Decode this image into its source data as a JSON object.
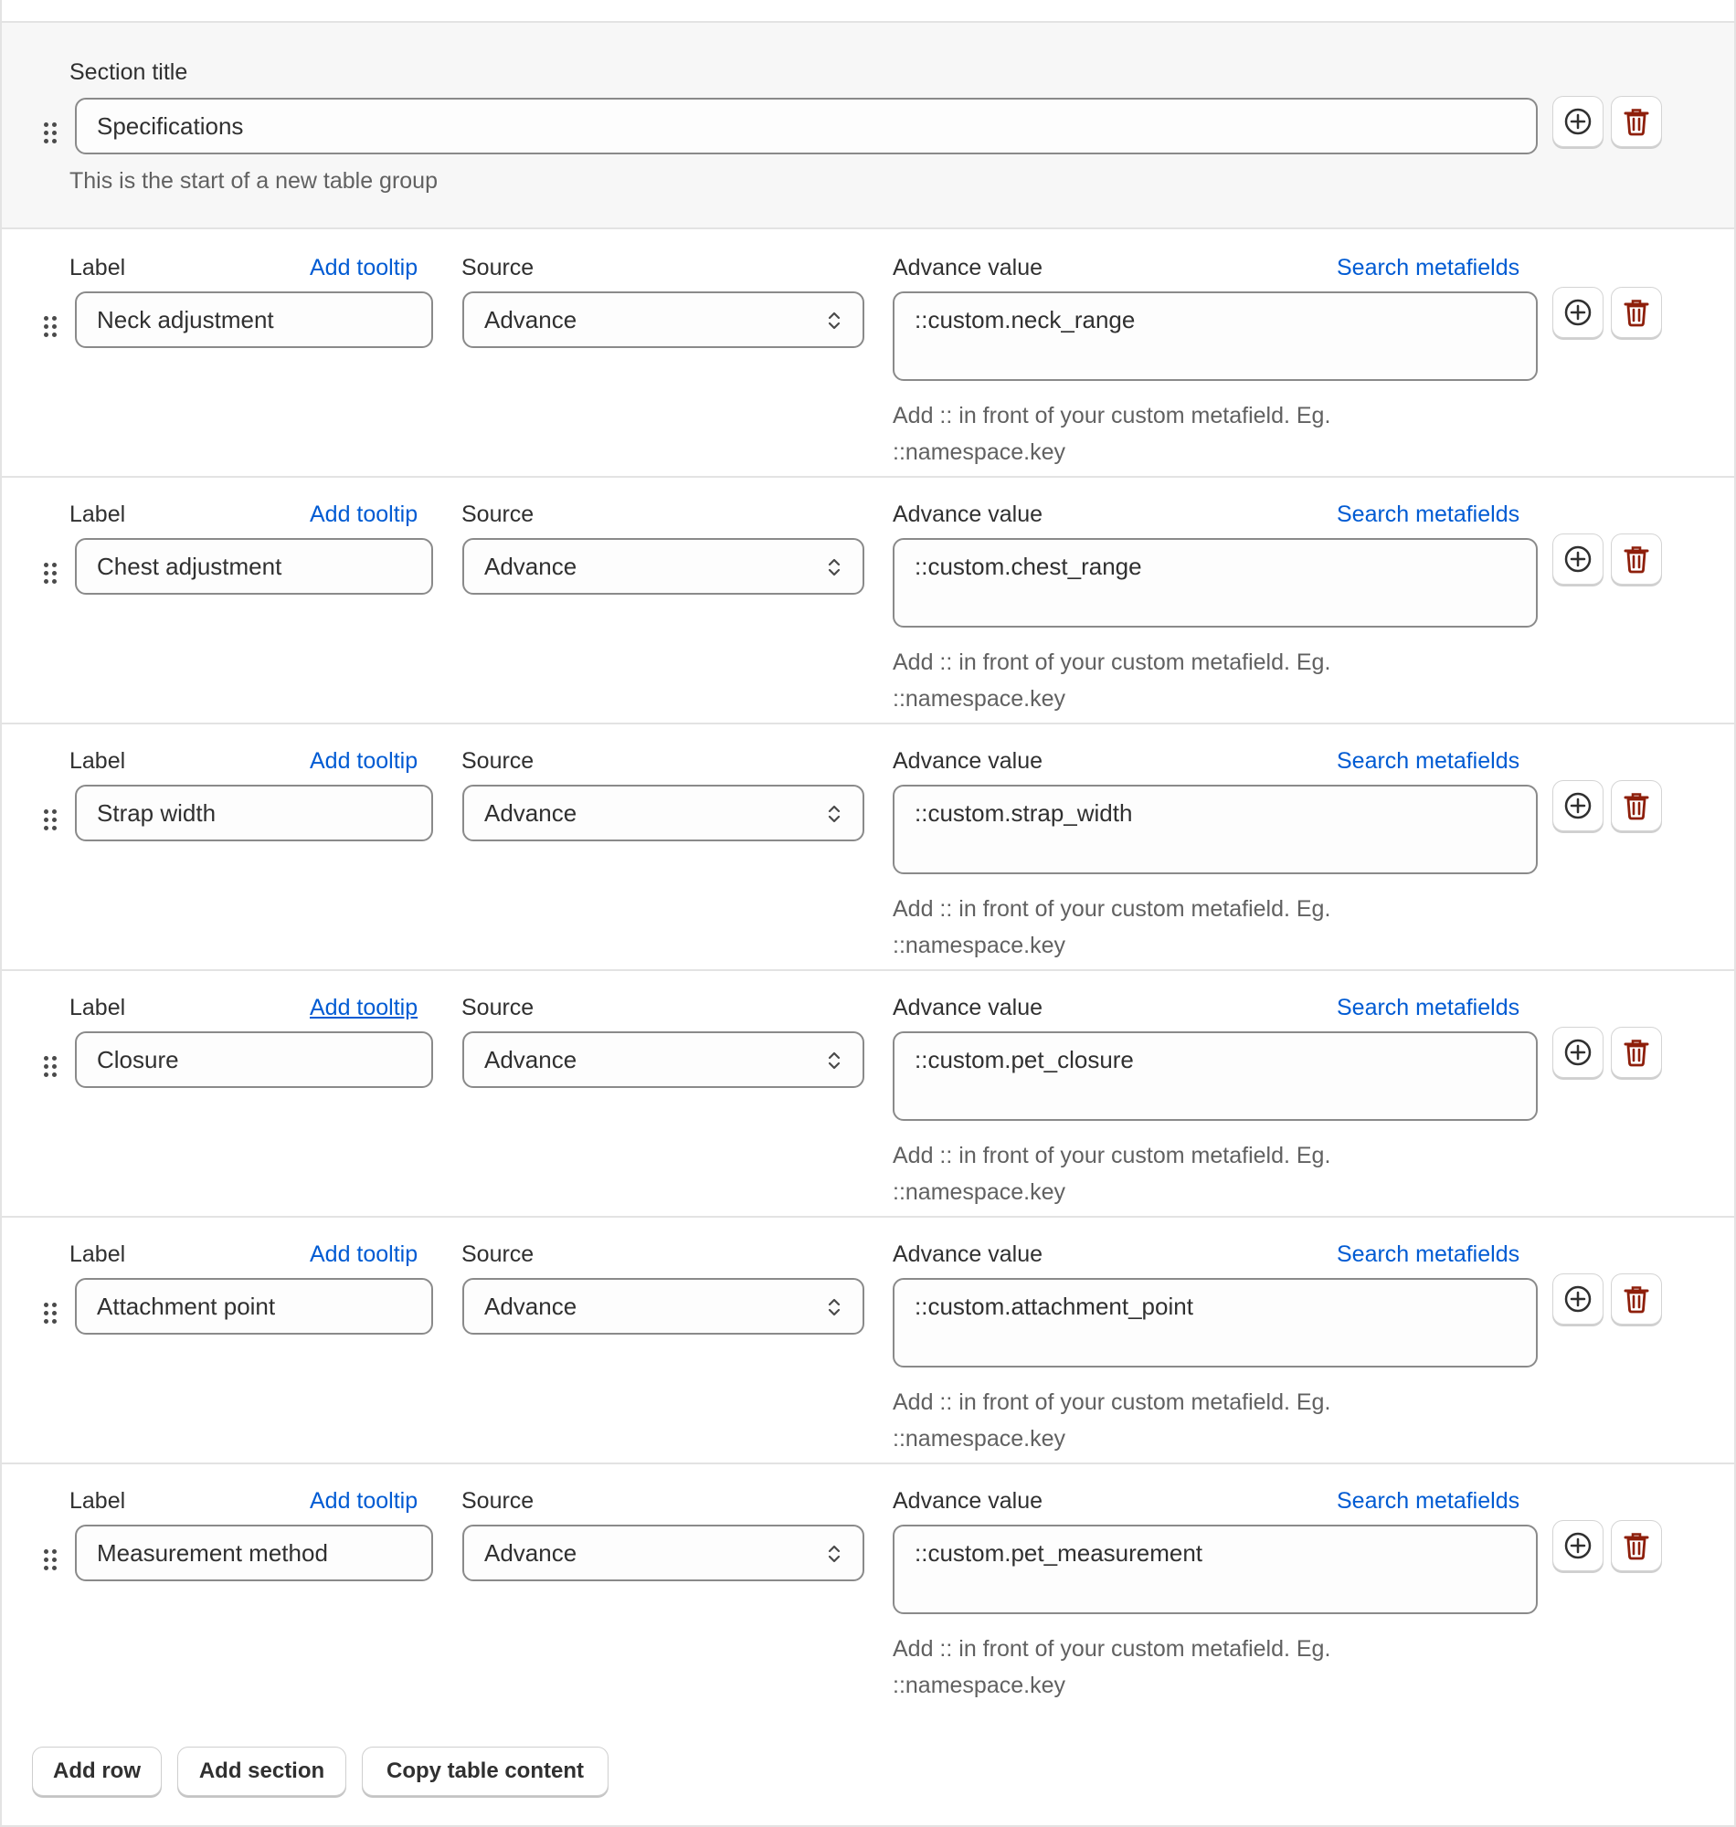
{
  "section": {
    "title_label": "Section title",
    "title_value": "Specifications",
    "help": "This is the start of a new table group"
  },
  "rows": [
    {
      "label_heading": "Label",
      "tooltip_link": "Add tooltip",
      "source_heading": "Source",
      "value_heading": "Advance value",
      "search_link": "Search metafields",
      "label_value": "Neck adjustment",
      "source_value": "Advance",
      "advance_value": "::custom.neck_range",
      "help_line1": "Add :: in front of your custom metafield. Eg.",
      "help_line2": "::namespace.key"
    },
    {
      "label_heading": "Label",
      "tooltip_link": "Add tooltip",
      "source_heading": "Source",
      "value_heading": "Advance value",
      "search_link": "Search metafields",
      "label_value": "Chest adjustment",
      "source_value": "Advance",
      "advance_value": "::custom.chest_range",
      "help_line1": "Add :: in front of your custom metafield. Eg.",
      "help_line2": "::namespace.key"
    },
    {
      "label_heading": "Label",
      "tooltip_link": "Add tooltip",
      "source_heading": "Source",
      "value_heading": "Advance value",
      "search_link": "Search metafields",
      "label_value": "Strap width",
      "source_value": "Advance",
      "advance_value": "::custom.strap_width",
      "help_line1": "Add :: in front of your custom metafield. Eg.",
      "help_line2": "::namespace.key"
    },
    {
      "label_heading": "Label",
      "tooltip_link": "Add tooltip",
      "source_heading": "Source",
      "value_heading": "Advance value",
      "search_link": "Search metafields",
      "label_value": "Closure",
      "source_value": "Advance",
      "advance_value": "::custom.pet_closure",
      "help_line1": "Add :: in front of your custom metafield. Eg.",
      "help_line2": "::namespace.key"
    },
    {
      "label_heading": "Label",
      "tooltip_link": "Add tooltip",
      "source_heading": "Source",
      "value_heading": "Advance value",
      "search_link": "Search metafields",
      "label_value": "Attachment point",
      "source_value": "Advance",
      "advance_value": "::custom.attachment_point",
      "help_line1": "Add :: in front of your custom metafield. Eg.",
      "help_line2": "::namespace.key"
    },
    {
      "label_heading": "Label",
      "tooltip_link": "Add tooltip",
      "source_heading": "Source",
      "value_heading": "Advance value",
      "search_link": "Search metafields",
      "label_value": "Measurement method",
      "source_value": "Advance",
      "advance_value": "::custom.pet_measurement",
      "help_line1": "Add :: in front of your custom metafield. Eg.",
      "help_line2": "::namespace.key"
    }
  ],
  "actions": {
    "add_row": "Add row",
    "add_section": "Add section",
    "copy_table": "Copy table content"
  },
  "icons": {
    "drag": "drag-handle-icon",
    "add": "plus-circle-icon",
    "delete": "trash-icon"
  },
  "colors": {
    "link": "#005bd3",
    "delete": "#8e1f0b",
    "section_bg": "#f7f7f7"
  }
}
